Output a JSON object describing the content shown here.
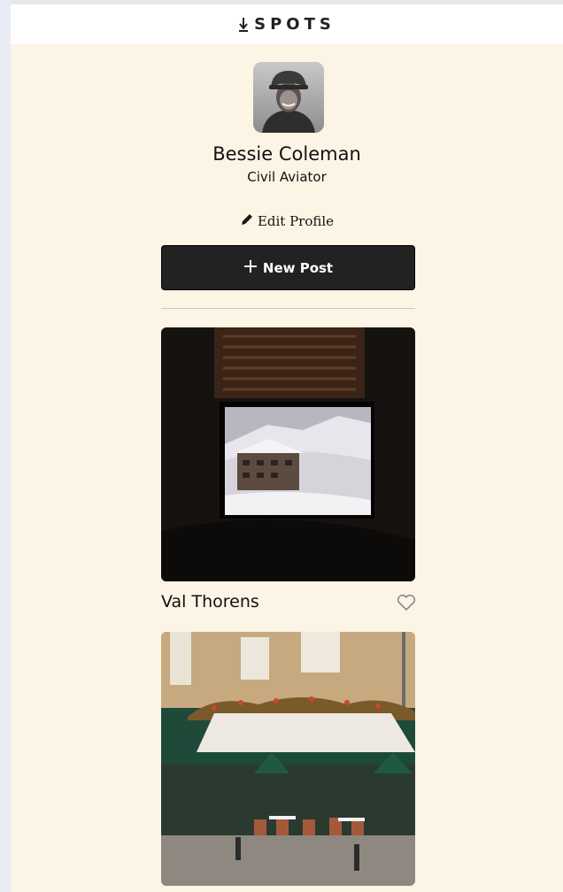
{
  "header": {
    "logo_text": "SPOTS",
    "logo_icon": "arrow-down-logo-icon"
  },
  "profile": {
    "name": "Bessie Coleman",
    "description": "Civil Aviator",
    "avatar_icon": "avatar-photo"
  },
  "actions": {
    "edit_label": "Edit Profile",
    "edit_icon": "pencil-icon",
    "new_post_label": "New Post",
    "new_post_icon": "plus-icon"
  },
  "cards": [
    {
      "title": "Val Thorens",
      "liked": false,
      "image": "snowy-mountain-through-window"
    },
    {
      "title": "",
      "image": "restaurant-terrace-facade"
    }
  ],
  "colors": {
    "page_bg": "#fcf5e5",
    "header_bg": "#ffffff",
    "button_bg": "#222222",
    "text": "#111111"
  }
}
